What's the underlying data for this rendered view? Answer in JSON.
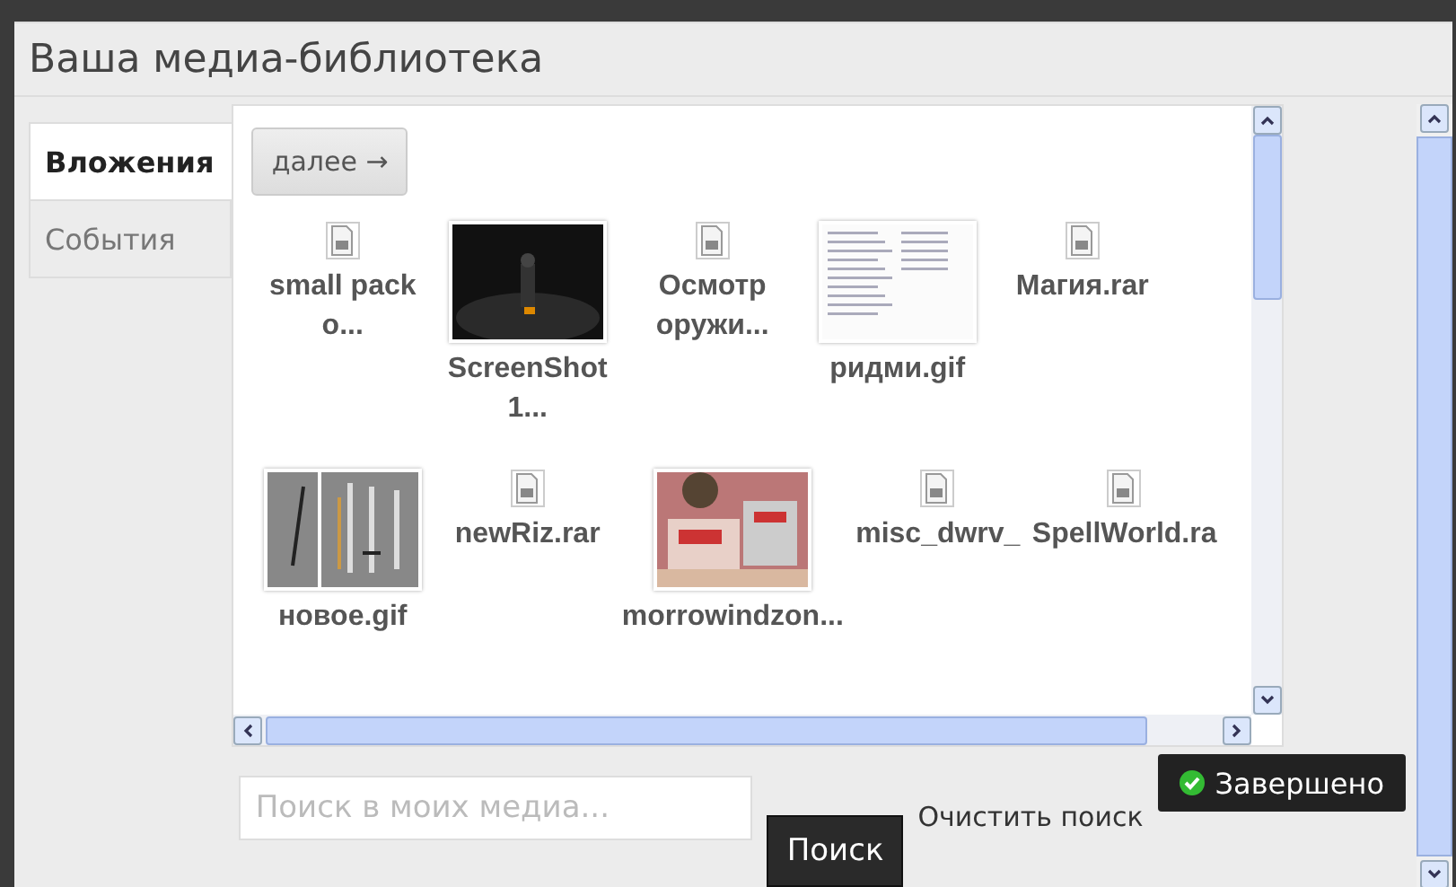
{
  "dialog": {
    "title": "Ваша медиа-библиотека"
  },
  "tabs": [
    {
      "label": "Вложения",
      "selected": true
    },
    {
      "label": "События",
      "selected": false
    }
  ],
  "next_button": {
    "label": "далее →"
  },
  "items": [
    {
      "kind": "file",
      "name": "small pack o..."
    },
    {
      "name": "ScreenShot 1..."
    },
    {
      "kind": "file",
      "name": "Осмотр оружи..."
    },
    {
      "name": "ридми.gif"
    },
    {
      "kind": "file",
      "name": "Магия.rar"
    },
    {
      "name": "новое.gif"
    },
    {
      "kind": "file",
      "name": "newRiz.rar"
    },
    {
      "name": "morrowindzon..."
    },
    {
      "kind": "file",
      "name": "misc_dwrv_"
    },
    {
      "kind": "file",
      "name": "SpellWorld.ra"
    }
  ],
  "search": {
    "placeholder": "Поиск в моих медиа...",
    "button": "Поиск",
    "clear": "Очистить поиск"
  },
  "done_button": {
    "label": "Завершено"
  }
}
